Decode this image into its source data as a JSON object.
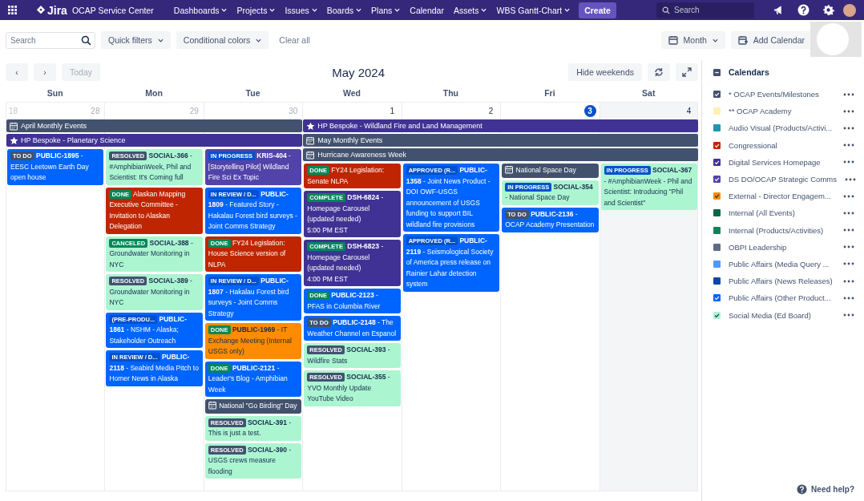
{
  "nav": {
    "product": "Jira",
    "site": "OCAP Service Center",
    "menus": [
      {
        "label": "Dashboards",
        "dropdown": true
      },
      {
        "label": "Projects",
        "dropdown": true
      },
      {
        "label": "Issues",
        "dropdown": true
      },
      {
        "label": "Boards",
        "dropdown": true
      },
      {
        "label": "Plans",
        "dropdown": true
      },
      {
        "label": "Calendar",
        "dropdown": false
      },
      {
        "label": "Assets",
        "dropdown": true
      },
      {
        "label": "WBS Gantt-Chart",
        "dropdown": true
      }
    ],
    "create": "Create",
    "search_placeholder": "Search"
  },
  "toolbar": {
    "search_placeholder": "Search",
    "filters": [
      "Quick filters",
      "Conditional colors"
    ],
    "clear": "Clear all",
    "view": "Month",
    "add": "Add Calendar"
  },
  "calendar": {
    "title": "May 2024",
    "prev": "‹",
    "next": "›",
    "today": "Today",
    "today_disabled": true,
    "hide_weekends": "Hide weekends",
    "days": [
      {
        "name": "Sun",
        "week": "18",
        "date": "28",
        "other_month": true,
        "today": false,
        "weekend": false,
        "events": [
          {
            "kind": "todo",
            "status": "TO DO",
            "key": "PUBLIC-1895",
            "title": "- EESC Leetown Earth Day open house",
            "color": "#0065ff"
          }
        ]
      },
      {
        "name": "Mon",
        "date": "29",
        "other_month": true,
        "today": false,
        "weekend": false,
        "events": [
          {
            "kind": "todo",
            "status": "RESOLVED",
            "key": "SOCIAL-366",
            "title": "- #AmphibianWeek, Phil and Scientist: It's Coming full",
            "color": "#abf5d1"
          },
          {
            "kind": "done",
            "status": "DONE",
            "title": "Alaskan Mapping Executive Committee - Invitation to Alaskan Delegation",
            "color": "#bf2600"
          },
          {
            "kind": "done",
            "status": "CANCELED",
            "key": "SOCIAL-388",
            "title": "- Groundwater Monitoring in NYC",
            "color": "#abf5d1"
          },
          {
            "kind": "todo",
            "status": "RESOLVED",
            "key": "SOCIAL-389",
            "title": "- Groundwater Monitoring in NYC",
            "color": "#abf5d1"
          },
          {
            "kind": "inprogress",
            "status": "(PRE-PRODU...",
            "key": "PUBLIC-1861",
            "title": "- NSHM - Alaska; Stakeholder Outreach",
            "color": "#0065ff"
          },
          {
            "kind": "inprogress",
            "status": "IN REVIEW / D...",
            "key": "PUBLIC-2118",
            "title": "- Seabird Media Pitch to Homer News in Alaska",
            "color": "#0065ff"
          }
        ]
      },
      {
        "name": "Tue",
        "date": "30",
        "other_month": true,
        "today": false,
        "weekend": false,
        "events": [
          {
            "kind": "inprogress",
            "status": "IN PROGRESS",
            "key": "KRIS-404",
            "title": "- [Storytelling Pilot] Wildland Fire Sci Ex Topic",
            "color": "#5243aa"
          },
          {
            "kind": "inprogress",
            "status": "IN REVIEW / D...",
            "key": "PUBLIC-1809",
            "title": "- Featured Story - Hakalau Forest bird surveys - Joint Comms Strategy",
            "color": "#0065ff"
          },
          {
            "kind": "done",
            "status": "DONE",
            "title": "FY24 Legislation: House Science version of NLPA",
            "color": "#bf2600"
          },
          {
            "kind": "inprogress",
            "status": "IN REVIEW / D...",
            "key": "PUBLIC-1807",
            "title": "- Hakalau Forest bird surveys - Joint Comms Strategy",
            "color": "#0065ff"
          },
          {
            "kind": "done",
            "status": "DONE",
            "key": "PUBLIC-1969",
            "title": "- IT Exchange Meeting (Internal USGS only)",
            "color": "#ff8b00"
          },
          {
            "kind": "done",
            "status": "DONE",
            "key": "PUBLIC-2121",
            "title": "- Leader's Blog - Amphibian Week",
            "color": "#0065ff"
          },
          {
            "kind": "event",
            "title": "National \"Go Birding\" Day",
            "color": "#42526e"
          },
          {
            "kind": "todo",
            "status": "RESOLVED",
            "key": "SOCIAL-391",
            "title": "- This is just a test.",
            "color": "#abf5d1"
          },
          {
            "kind": "todo",
            "status": "RESOLVED",
            "key": "SOCIAL-390",
            "title": "- USGS crews measure flooding",
            "color": "#abf5d1"
          }
        ]
      },
      {
        "name": "Wed",
        "date": "1",
        "other_month": false,
        "today": false,
        "weekend": false,
        "events": [
          {
            "kind": "done",
            "status": "DONE",
            "title": "FY24 Legislation: Senate NLPA",
            "color": "#bf2600"
          },
          {
            "kind": "done",
            "status": "COMPLETE",
            "key": "DSH-6824",
            "title": "- Homepage Carousel (updated needed)",
            "time": "5:00 PM EST",
            "color": "#403294"
          },
          {
            "kind": "done",
            "status": "COMPLETE",
            "key": "DSH-6823",
            "title": "- Homepage Carousel (updated needed)",
            "time": "4:00 PM EST",
            "color": "#403294"
          },
          {
            "kind": "done",
            "status": "DONE",
            "key": "PUBLIC-2123",
            "title": "- PFAS in Columbia River",
            "color": "#0065ff"
          },
          {
            "kind": "todo",
            "status": "TO DO",
            "key": "PUBLIC-2148",
            "title": "- The Weather Channel en Espanol",
            "color": "#0065ff"
          },
          {
            "kind": "todo",
            "status": "RESOLVED",
            "key": "SOCIAL-393",
            "title": "- Wildfire Stats",
            "color": "#abf5d1"
          },
          {
            "kind": "todo",
            "status": "RESOLVED",
            "key": "SOCIAL-355",
            "title": "- YVO Monthly Update YouTube Video",
            "color": "#abf5d1"
          }
        ]
      },
      {
        "name": "Thu",
        "date": "2",
        "other_month": false,
        "today": false,
        "weekend": false,
        "events": [
          {
            "kind": "inprogress",
            "status": "APPROVED (R...",
            "key": "PUBLIC-1358",
            "title": "- Joint News Product - DOI OWF-USGS announcement of USGS funding to support BIL wildland fire provisions",
            "color": "#0065ff"
          },
          {
            "kind": "inprogress",
            "status": "APPROVED (R...",
            "key": "PUBLIC-2119",
            "title": "- Seismological Society of America press release on Rainier Lahar detection system",
            "color": "#0065ff"
          }
        ]
      },
      {
        "name": "Fri",
        "date": "3",
        "other_month": false,
        "today": true,
        "weekend": false,
        "events": [
          {
            "kind": "event",
            "title": "National Space Day",
            "color": "#42526e"
          },
          {
            "kind": "inprogress",
            "status": "IN PROGRESS",
            "key": "SOCIAL-354",
            "title": "- National Space Day",
            "color": "#abf5d1"
          },
          {
            "kind": "todo",
            "status": "TO DO",
            "key": "PUBLIC-2136",
            "title": "- OCAP Academy Presentation",
            "color": "#0065ff"
          }
        ]
      },
      {
        "name": "Sat",
        "date": "4",
        "other_month": false,
        "today": false,
        "weekend": true,
        "events": [
          {
            "kind": "inprogress",
            "status": "IN PROGRESS",
            "key": "SOCIAL-367",
            "title": "- #AmphibianWeek - Phil and Scientist: Introducing \"Phil and Scientist\"",
            "color": "#abf5d1"
          }
        ]
      }
    ],
    "bars": [
      {
        "label": "April Monthly Events",
        "kind": "event",
        "color": "#42526e"
      },
      {
        "label": "HP Bespoke - Wildland Fire and Land Management",
        "kind": "highlight",
        "color": "#403294"
      },
      {
        "label": "HP Bespoke - Planetary Science",
        "kind": "highlight",
        "color": "#403294"
      },
      {
        "label": "May Monthly Events",
        "kind": "event",
        "color": "#42526e"
      },
      {
        "label": "Hurricane Awareness Week",
        "kind": "event",
        "color": "#42526e"
      }
    ]
  },
  "sidebar": {
    "title": "Calendars",
    "calendars": [
      {
        "label": "* OCAP Events/Milestones",
        "color": "#42526e",
        "checked": true
      },
      {
        "label": "** OCAP Academy",
        "color": "#fff0b3",
        "checked": false
      },
      {
        "label": "Audio Visual (Products/Activi...",
        "color": "#1d97b0",
        "checked": false
      },
      {
        "label": "Congressional",
        "color": "#bf2600",
        "checked": true
      },
      {
        "label": "Digital Services Homepage",
        "color": "#403294",
        "checked": true
      },
      {
        "label": "DS DO/OCAP Strategic Comms",
        "color": "#5243aa",
        "checked": true
      },
      {
        "label": "External - Director Engagem...",
        "color": "#ff8b00",
        "checked": true
      },
      {
        "label": "Internal (All Events)",
        "color": "#006644",
        "checked": false
      },
      {
        "label": "Internal (Products/Activities)",
        "color": "#00875a",
        "checked": false
      },
      {
        "label": "OBPI Leadership",
        "color": "#5e6c84",
        "checked": false
      },
      {
        "label": "Public Affairs (Media Query ...",
        "color": "#4c9aff",
        "checked": false
      },
      {
        "label": "Public Affairs (News Releases)",
        "color": "#0747a6",
        "checked": false
      },
      {
        "label": "Public Affairs (Other Product...",
        "color": "#0065ff",
        "checked": true
      },
      {
        "label": "Social Media (Ed Board)",
        "color": "#abf5d1",
        "checked": true
      }
    ],
    "help": "Need help?"
  }
}
